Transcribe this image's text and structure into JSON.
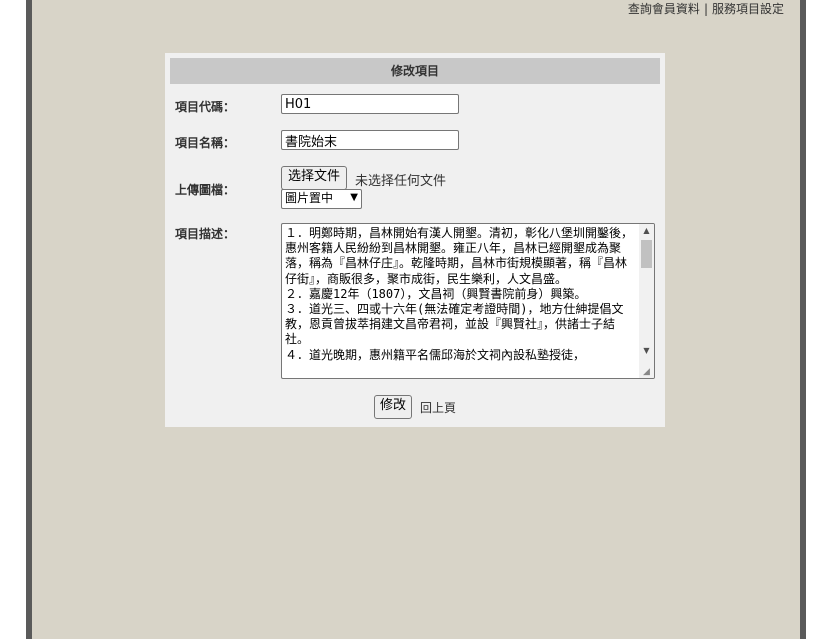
{
  "top_links": {
    "query_member": "查詢會員資料",
    "separator": "|",
    "service_settings": "服務項目設定"
  },
  "form": {
    "title": "修改項目",
    "code_label": "項目代碼：",
    "code_value": "H01",
    "name_label": "項目名稱：",
    "name_value": "書院始末",
    "upload_label": "上傳圖檔：",
    "file_button": "选择文件",
    "file_status": "未选择任何文件",
    "image_position_selected": "圖片置中",
    "description_label": "項目描述：",
    "description_text": "１．明鄭時期，昌林開始有漢人開墾。清初，彰化八堡圳開鑿後，惠州客籍人民紛紛到昌林開墾。雍正八年，昌林已經開墾成為聚落，稱為『昌林仔庄』。乾隆時期，昌林市街規模顯著，稱『昌林仔街』，商販很多，聚市成街，民生樂利，人文昌盛。\n２．嘉慶12年（1807），文昌祠（興賢書院前身）興築。\n３．道光三、四或十六年(無法確定考證時間)，地方仕紳提倡文教，恩貢曾拔萃捐建文昌帝君祠，並設『興賢社』，供諸士子結社。\n４．道光晚期，惠州籍平名儒邱海於文祠內設私塾授徒，",
    "submit_button": "修改",
    "back_link": "回上頁"
  },
  "icons": {
    "select_chevron": "chevron-down-icon",
    "scroll_up": "arrow-up-icon",
    "scroll_down": "arrow-down-icon",
    "resize": "resize-grip-icon"
  }
}
